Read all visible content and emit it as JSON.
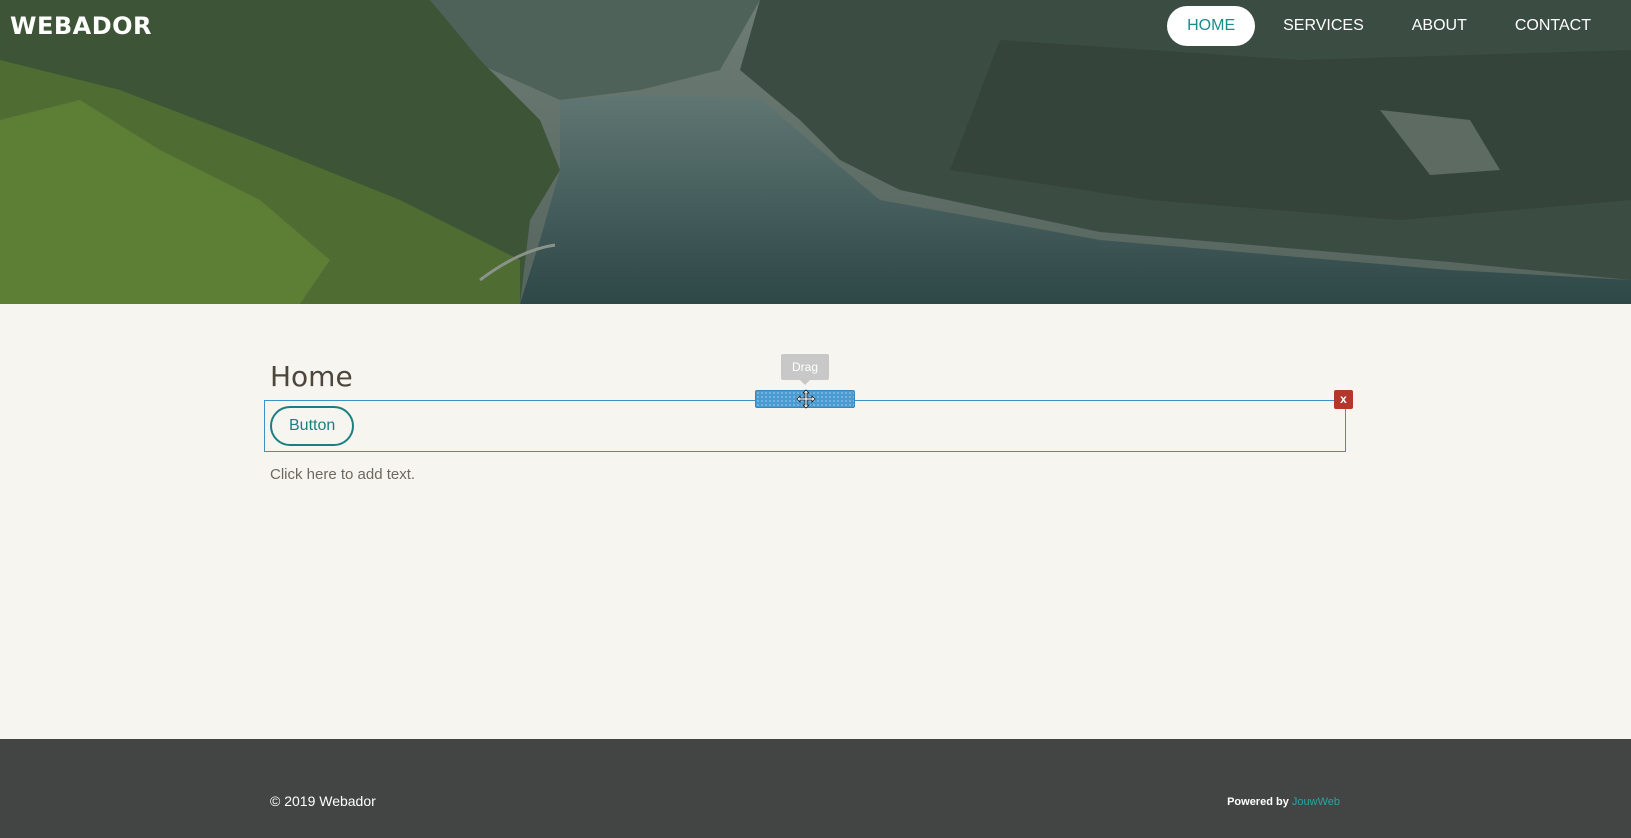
{
  "site": {
    "logo": "WEBADOR"
  },
  "nav": {
    "items": [
      {
        "label": "HOME",
        "active": true
      },
      {
        "label": "SERVICES",
        "active": false
      },
      {
        "label": "ABOUT",
        "active": false
      },
      {
        "label": "CONTACT",
        "active": false
      }
    ]
  },
  "hero": {
    "image_icon": "fjord-landscape-image"
  },
  "content": {
    "title": "Home",
    "button_label": "Button",
    "add_text": "Click here to add text."
  },
  "editor": {
    "drag_tooltip": "Drag",
    "drag_icon": "move-icon",
    "close_label": "x",
    "close_icon": "close-icon",
    "selection_color": "#3a93c4",
    "close_color": "#b5362c"
  },
  "footer": {
    "copyright": "© 2019 Webador",
    "powered_by": "Powered by",
    "powered_link": "JouwWeb"
  },
  "colors": {
    "accent": "#1b7f7f",
    "footer_bg": "#434544",
    "content_bg": "#f7f5f0"
  }
}
